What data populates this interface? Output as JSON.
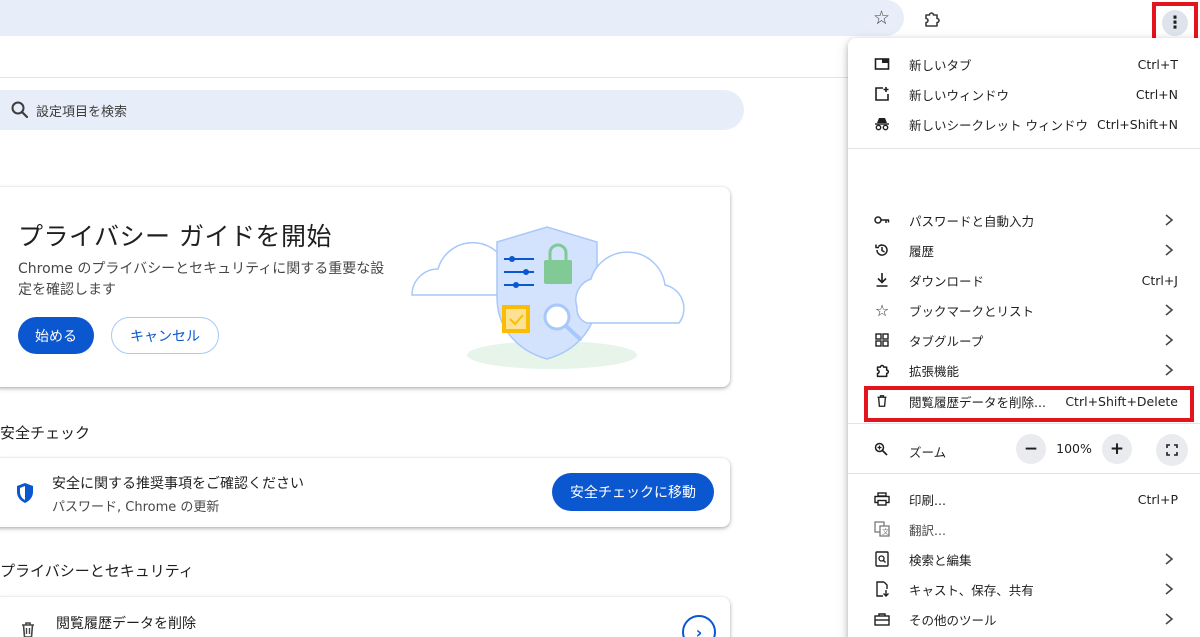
{
  "toolbar": {
    "bookmark_icon": "star-outline",
    "extensions_icon": "puzzle-piece",
    "menu_icon": "three-dots-vertical"
  },
  "search": {
    "placeholder": "設定項目を検索"
  },
  "privacy_guide": {
    "title": "プライバシー ガイドを開始",
    "description": "Chrome のプライバシーとセキュリティに関する重要な設定を確認します",
    "start_label": "始める",
    "cancel_label": "キャンセル"
  },
  "safety_check": {
    "heading": "安全チェック",
    "line1": "安全に関する推奨事項をご確認ください",
    "line2": "パスワード, Chrome の更新",
    "button_label": "安全チェックに移動"
  },
  "privacy_security": {
    "heading": "プライバシーとセキュリティ",
    "row_label": "閲覧履歴データを削除"
  },
  "menu": {
    "new_tab": {
      "label": "新しいタブ",
      "shortcut": "Ctrl+T"
    },
    "new_window": {
      "label": "新しいウィンドウ",
      "shortcut": "Ctrl+N"
    },
    "incognito": {
      "label": "新しいシークレット ウィンドウ",
      "shortcut": "Ctrl+Shift+N"
    },
    "passwords": {
      "label": "パスワードと自動入力"
    },
    "history": {
      "label": "履歴"
    },
    "downloads": {
      "label": "ダウンロード",
      "shortcut": "Ctrl+J"
    },
    "bookmarks": {
      "label": "ブックマークとリスト"
    },
    "tab_groups": {
      "label": "タブグループ"
    },
    "extensions": {
      "label": "拡張機能"
    },
    "clear_data": {
      "label": "閲覧履歴データを削除...",
      "shortcut": "Ctrl+Shift+Delete"
    },
    "zoom": {
      "label": "ズーム",
      "value": "100%",
      "minus": "−",
      "plus": "+"
    },
    "print": {
      "label": "印刷...",
      "shortcut": "Ctrl+P"
    },
    "translate": {
      "label": "翻訳..."
    },
    "search_edit": {
      "label": "検索と編集"
    },
    "cast_save_share": {
      "label": "キャスト、保存、共有"
    },
    "more_tools": {
      "label": "その他のツール"
    }
  },
  "colors": {
    "accent": "#0b57d0",
    "highlight": "#e3141c",
    "omnibox_bg": "#e8eef9"
  }
}
